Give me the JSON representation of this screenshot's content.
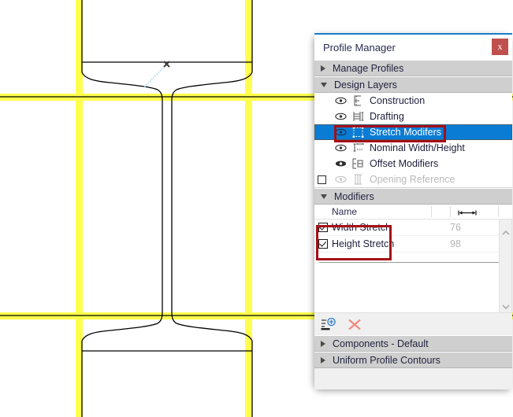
{
  "window": {
    "title": "Profile Manager",
    "close_label": "x",
    "accent_top_color": "#1a7ec8",
    "close_button_color": "#c0504d"
  },
  "sections": {
    "manage_profiles": {
      "label": "Manage Profiles",
      "expanded": false,
      "arrow": "triangle-right-icon"
    },
    "design_layers": {
      "label": "Design Layers",
      "expanded": true,
      "arrow": "triangle-down-icon"
    },
    "modifiers": {
      "label": "Modifiers",
      "expanded": true,
      "arrow": "triangle-down-icon"
    },
    "components": {
      "label": "Components - Default",
      "expanded": false,
      "arrow": "triangle-right-icon"
    },
    "uniform_contours": {
      "label": "Uniform Profile Contours",
      "expanded": false,
      "arrow": "triangle-right-icon"
    }
  },
  "design_layers": {
    "selection_color": "#0a7cd4",
    "rows": [
      {
        "label": "Construction",
        "visibility_icon": "eye-icon",
        "type_icon": "construction-layer-icon",
        "selected": false,
        "disabled": false,
        "has_checkbox": false,
        "checked": false
      },
      {
        "label": "Drafting",
        "visibility_icon": "eye-icon",
        "type_icon": "drafting-layer-icon",
        "selected": false,
        "disabled": false,
        "has_checkbox": false,
        "checked": false
      },
      {
        "label": "Stretch Modifers",
        "visibility_icon": "eye-icon",
        "type_icon": "stretch-modifier-icon",
        "selected": true,
        "disabled": false,
        "has_checkbox": false,
        "checked": false
      },
      {
        "label": "Nominal Width/Height",
        "visibility_icon": "eye-icon",
        "type_icon": "nominal-dimension-icon",
        "selected": false,
        "disabled": false,
        "has_checkbox": false,
        "checked": false
      },
      {
        "label": "Offset Modifiers",
        "visibility_icon": "eye-filled-icon",
        "type_icon": "offset-modifier-icon",
        "selected": false,
        "disabled": false,
        "has_checkbox": false,
        "checked": false
      },
      {
        "label": "Opening Reference",
        "visibility_icon": "eye-icon",
        "type_icon": "opening-reference-icon",
        "selected": false,
        "disabled": true,
        "has_checkbox": true,
        "checked": false
      }
    ]
  },
  "modifiers_table": {
    "columns": [
      {
        "key": "name",
        "label": "Name",
        "icon": null
      },
      {
        "key": "blank",
        "label": "",
        "icon": null
      },
      {
        "key": "value",
        "label": "",
        "icon": "horizontal-arrows-icon"
      }
    ],
    "rows": [
      {
        "checked": true,
        "name": "Width Stretch",
        "value": "76"
      },
      {
        "checked": true,
        "name": "Height Stretch",
        "value": "98"
      }
    ],
    "scrollbar": {
      "up_icon": "chevron-up-icon",
      "down_icon": "chevron-down-icon"
    }
  },
  "modifiers_toolbar": {
    "add": {
      "icon": "add-to-list-icon",
      "color": "#2f7fd1"
    },
    "delete": {
      "icon": "delete-x-icon",
      "color": "#f08a80"
    }
  },
  "drawing": {
    "guide_color": "#ffff4d",
    "outline_color": "#000000",
    "cursor_marker": "x-cursor-icon",
    "rubber_band_color": "#9fd4f5",
    "description": "I-beam / steel profile cross-section with yellow snap guide lines"
  },
  "annotations": [
    {
      "target": "stretch-modifers-row",
      "color": "#a51018"
    },
    {
      "target": "stretch-modifier-rows",
      "color": "#a51018"
    }
  ]
}
